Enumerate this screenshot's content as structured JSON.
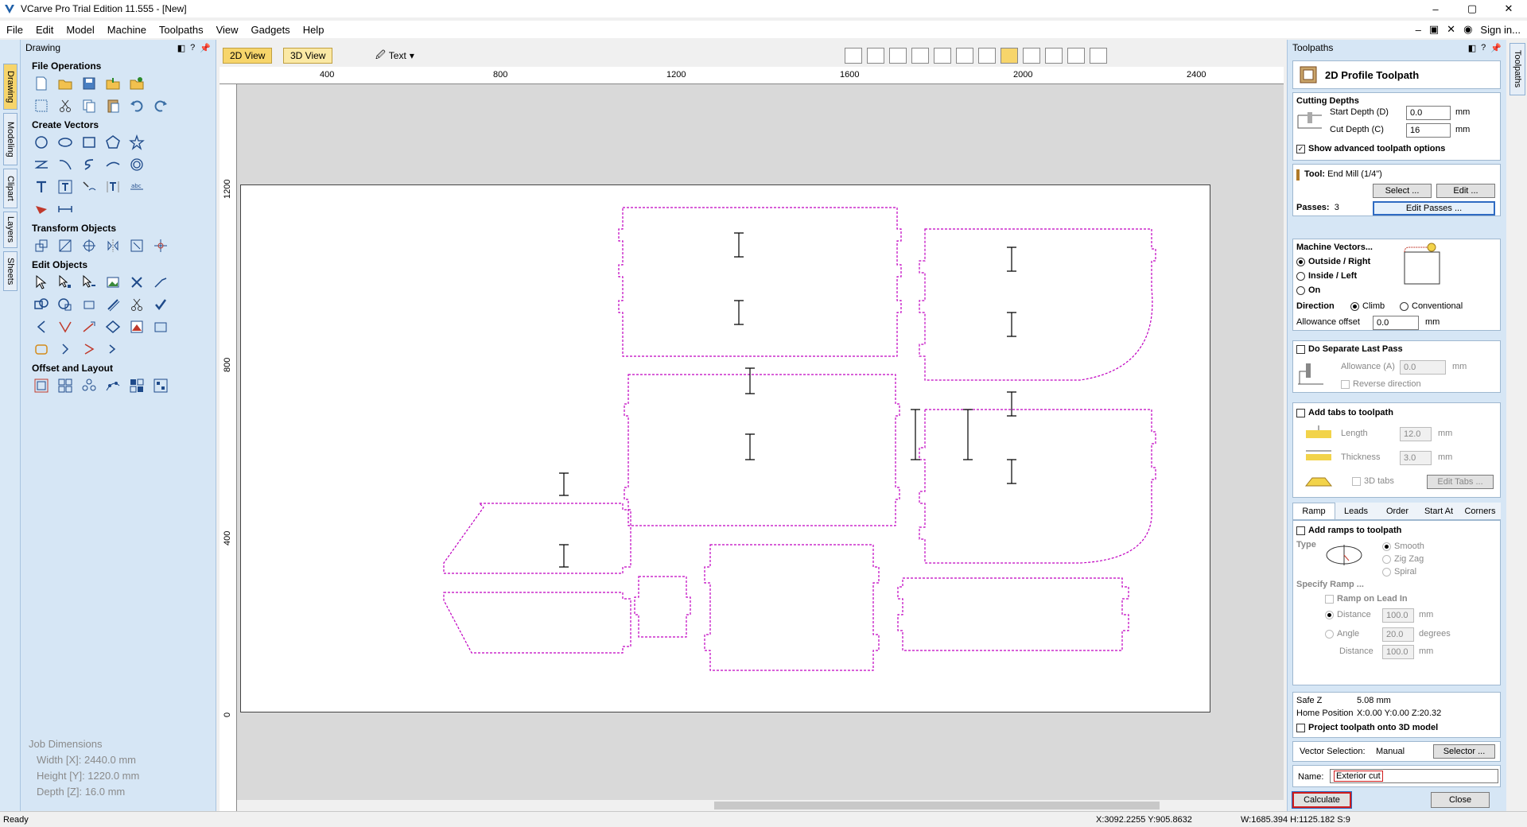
{
  "window": {
    "title": "VCarve Pro Trial Edition 11.555 - [New]",
    "minimize": "–",
    "maximize": "▢",
    "close": "✕"
  },
  "menu": {
    "items": [
      "File",
      "Edit",
      "Model",
      "Machine",
      "Toolpaths",
      "View",
      "Gadgets",
      "Help"
    ],
    "sign_in": "Sign in...",
    "inner_min": "–",
    "inner_restore": "▣",
    "inner_close": "✕"
  },
  "left_tabs": [
    "Drawing",
    "Modeling",
    "Clipart",
    "Layers",
    "Sheets"
  ],
  "drawing_panel": {
    "title": "Drawing",
    "sections": [
      "File Operations",
      "Create Vectors",
      "Transform Objects",
      "Edit Objects",
      "Offset and Layout"
    ]
  },
  "job_dimensions": {
    "title": "Job Dimensions",
    "width": "Width  [X]: 2440.0 mm",
    "height": "Height [Y]: 1220.0 mm",
    "depth": "Depth  [Z]: 16.0 mm"
  },
  "view_toolbar": {
    "tab_2d": "2D View",
    "tab_3d": "3D View",
    "text_dropdown": "Text"
  },
  "rulers": {
    "top": [
      "400",
      "800",
      "1200",
      "1600",
      "2000",
      "2400"
    ],
    "left": [
      "1200",
      "800",
      "400",
      "0"
    ]
  },
  "toolpaths_panel": {
    "header": "Toolpaths",
    "vtab": "Toolpaths",
    "title": "2D Profile Toolpath",
    "cutting_depths": {
      "label": "Cutting Depths",
      "start_depth_label": "Start Depth (D)",
      "start_depth_value": "0.0",
      "start_unit": "mm",
      "cut_depth_label": "Cut Depth (C)",
      "cut_depth_value": "16",
      "cut_unit": "mm",
      "show_advanced": "Show advanced toolpath options"
    },
    "tool": {
      "label": "Tool:",
      "value": "End Mill (1/4\")",
      "select": "Select ...",
      "edit": "Edit ..."
    },
    "passes": {
      "label": "Passes:",
      "value": "3",
      "edit": "Edit Passes ..."
    },
    "machine_vectors": {
      "label": "Machine Vectors...",
      "outside": "Outside / Right",
      "inside": "Inside / Left",
      "on": "On",
      "direction_label": "Direction",
      "climb": "Climb",
      "conventional": "Conventional",
      "allowance_label": "Allowance offset",
      "allowance_value": "0.0",
      "allowance_unit": "mm"
    },
    "separate_last_pass": {
      "label": "Do Separate Last Pass",
      "allowance_label": "Allowance (A)",
      "allowance_value": "0.0",
      "allowance_unit": "mm",
      "reverse": "Reverse direction"
    },
    "tabs": {
      "label": "Add tabs to toolpath",
      "length_label": "Length",
      "length_value": "12.0",
      "length_unit": "mm",
      "thickness_label": "Thickness",
      "thickness_value": "3.0",
      "thickness_unit": "mm",
      "tabs3d": "3D tabs",
      "edit_tabs": "Edit Tabs ..."
    },
    "sub_tabs": [
      "Ramp",
      "Leads",
      "Order",
      "Start At",
      "Corners"
    ],
    "ramp": {
      "label": "Add ramps to toolpath",
      "type_label": "Type",
      "smooth": "Smooth",
      "zigzag": "Zig Zag",
      "spiral": "Spiral",
      "specify": "Specify Ramp ...",
      "ramp_on_lead": "Ramp on Lead In",
      "distance_label": "Distance",
      "distance_value": "100.0",
      "distance_unit": "mm",
      "angle_label": "Angle",
      "angle_value": "20.0",
      "angle_unit": "degrees",
      "distance2_label": "Distance",
      "distance2_value": "100.0",
      "distance2_unit": "mm"
    },
    "safe_z_label": "Safe Z",
    "safe_z_value": "5.08 mm",
    "home_label": "Home Position",
    "home_value": "X:0.00 Y:0.00 Z:20.32",
    "project": "Project toolpath onto 3D model",
    "vector_selection_label": "Vector Selection:",
    "vector_selection_value": "Manual",
    "selector": "Selector ...",
    "name_label": "Name:",
    "name_value": "Exterior cut",
    "calculate": "Calculate",
    "close": "Close"
  },
  "status": {
    "left": "Ready",
    "coords": "X:3092.2255 Y:905.8632",
    "dims": "W:1685.394  H:1125.182  S:9"
  },
  "colors": {
    "accent": "#f7d56b",
    "panel": "#d6e6f5",
    "vector": "#c000c0"
  }
}
